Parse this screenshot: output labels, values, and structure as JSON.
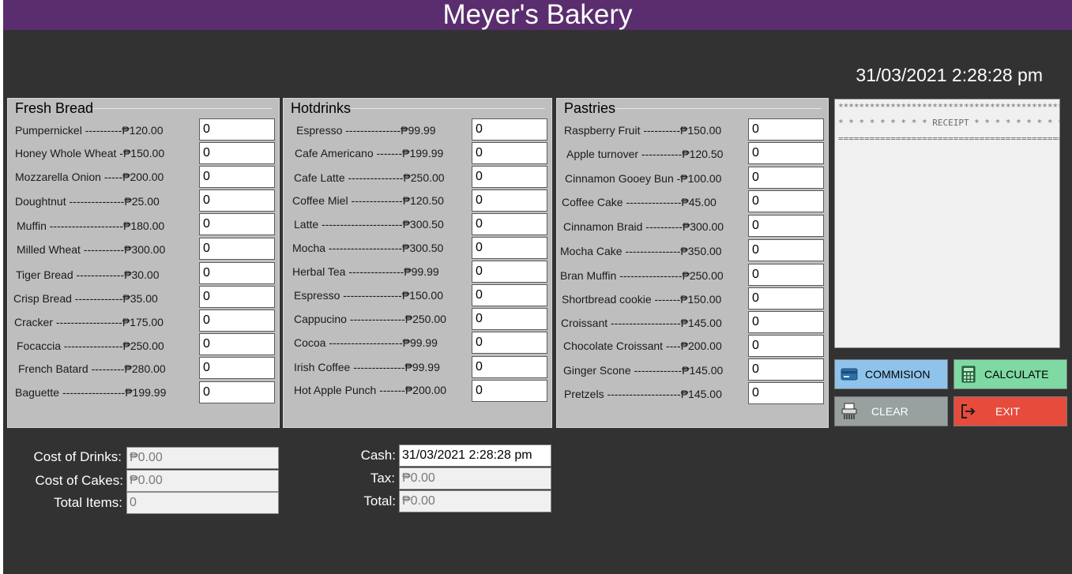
{
  "app": {
    "title": "Meyer's Bakery",
    "datetime": "31/03/2021 2:28:28 pm"
  },
  "fresh_bread": {
    "title": "Fresh Bread",
    "items": [
      {
        "label": "Pumpernickel ----------₱120.00",
        "qty": "0"
      },
      {
        "label": "Honey Whole Wheat -₱150.00",
        "qty": "0"
      },
      {
        "label": "Mozzarella Onion -----₱200.00",
        "qty": "0"
      },
      {
        "label": "Doughtnut ---------------₱25.00",
        "qty": "0"
      },
      {
        "label": "Muffin --------------------₱180.00",
        "qty": "0"
      },
      {
        "label": "Milled Wheat -----------₱300.00",
        "qty": "0"
      },
      {
        "label": "Tiger Bread -------------₱30.00",
        "qty": "0"
      },
      {
        "label": "Crisp Bread -------------₱35.00",
        "qty": "0"
      },
      {
        "label": "Cracker ------------------₱175.00",
        "qty": "0"
      },
      {
        "label": "Focaccia ----------------₱250.00",
        "qty": "0"
      },
      {
        "label": "French Batard ---------₱280.00",
        "qty": "0"
      },
      {
        "label": "Baguette -----------------₱199.99",
        "qty": "0"
      }
    ]
  },
  "hotdrinks": {
    "title": "Hotdrinks",
    "items": [
      {
        "label": "Espresso ---------------₱99.99",
        "qty": "0"
      },
      {
        "label": "Cafe Americano -------₱199.99",
        "qty": "0"
      },
      {
        "label": "Cafe Latte ---------------₱250.00",
        "qty": "0"
      },
      {
        "label": "Coffee Miel --------------₱120.50",
        "qty": "0"
      },
      {
        "label": "Latte ----------------------₱300.50",
        "qty": "0"
      },
      {
        "label": "Mocha --------------------₱300.50",
        "qty": "0"
      },
      {
        "label": "Herbal Tea ---------------₱99.99",
        "qty": "0"
      },
      {
        "label": "Espresso ----------------₱150.00",
        "qty": "0"
      },
      {
        "label": "Cappucino ---------------₱250.00",
        "qty": "0"
      },
      {
        "label": "Cocoa --------------------₱99.99",
        "qty": "0"
      },
      {
        "label": "Irish Coffee --------------₱99.99",
        "qty": "0"
      },
      {
        "label": "Hot Apple Punch -------₱200.00",
        "qty": "0"
      }
    ]
  },
  "pastries": {
    "title": "Pastries",
    "items": [
      {
        "label": "Raspberry Fruit ----------₱150.00",
        "qty": "0"
      },
      {
        "label": "Apple turnover -----------₱120.50",
        "qty": "0"
      },
      {
        "label": "Cinnamon Gooey Bun -₱100.00",
        "qty": "0"
      },
      {
        "label": "Coffee Cake ---------------₱45.00",
        "qty": "0"
      },
      {
        "label": "Cinnamon Braid ----------₱300.00",
        "qty": "0"
      },
      {
        "label": "Mocha Cake ---------------₱350.00",
        "qty": "0"
      },
      {
        "label": "Bran Muffin -----------------₱250.00",
        "qty": "0"
      },
      {
        "label": "Shortbread cookie -------₱150.00",
        "qty": "0"
      },
      {
        "label": "Croissant -------------------₱145.00",
        "qty": "0"
      },
      {
        "label": "Chocolate Croissant ----₱200.00",
        "qty": "0"
      },
      {
        "label": "Ginger Scone -------------₱145.00",
        "qty": "0"
      },
      {
        "label": "Pretzels --------------------₱145.00",
        "qty": "0"
      }
    ]
  },
  "receipt": {
    "line1": "**********************************************",
    "line2": "* * * * * * * * *  RECEIPT * * * * * * * * *",
    "line3": "============================================="
  },
  "buttons": {
    "commission": "COMMISION",
    "calculate": "CALCULATE",
    "clear": "CLEAR",
    "exit": "EXIT"
  },
  "summary": {
    "cost_drinks_label": "Cost of Drinks:",
    "cost_drinks": "₱0.00",
    "cost_cakes_label": "Cost of Cakes:",
    "cost_cakes": "₱0.00",
    "total_items_label": "Total Items:",
    "total_items": "0",
    "cash_label": "Cash:",
    "cash": "31/03/2021 2:28:28 pm",
    "tax_label": "Tax:",
    "tax": "₱0.00",
    "total_label": "Total:",
    "total": "₱0.00"
  },
  "colors": {
    "title_bar": "#5a2d6e",
    "background": "#323232",
    "panel": "#bfbebe",
    "commission": "#8fc3eb",
    "calculate": "#7fd9a3",
    "clear": "#98a19f",
    "exit": "#e64b3c"
  },
  "icons": {
    "commission": "credit-card-icon",
    "calculate": "calculator-icon",
    "clear": "shredder-icon",
    "exit": "exit-icon"
  }
}
